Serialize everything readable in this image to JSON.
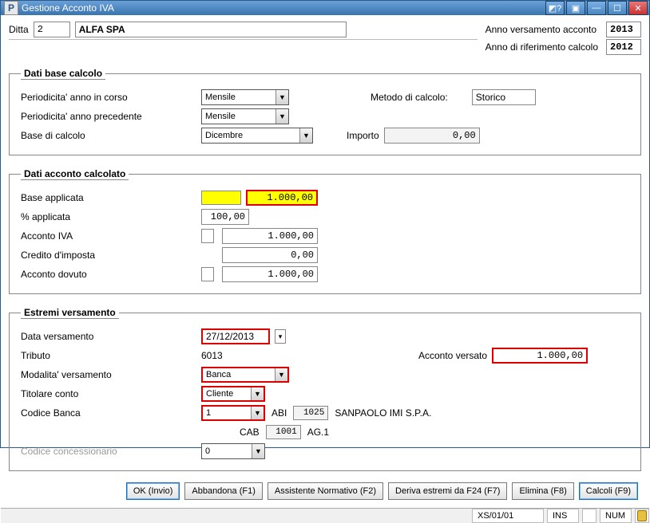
{
  "window": {
    "title": "Gestione Acconto IVA"
  },
  "header": {
    "ditta_label": "Ditta",
    "ditta_num": "2",
    "ditta_name": "ALFA SPA",
    "year_vers_label": "Anno versamento acconto",
    "year_vers_value": "2013",
    "year_calc_label": "Anno di riferimento calcolo",
    "year_calc_value": "2012"
  },
  "base": {
    "legend": "Dati base calcolo",
    "period_corso_label": "Periodicita' anno in corso",
    "period_corso_value": "Mensile",
    "method_label": "Metodo di calcolo:",
    "method_value": "Storico",
    "period_prec_label": "Periodicita' anno precedente",
    "period_prec_value": "Mensile",
    "base_calc_label": "Base di calcolo",
    "base_calc_value": "Dicembre",
    "importo_label": "Importo",
    "importo_value": "0,00"
  },
  "calc": {
    "legend": "Dati acconto calcolato",
    "base_app_label": "Base applicata",
    "base_app_value": "1.000,00",
    "pct_label": "% applicata",
    "pct_value": "100,00",
    "iva_label": "Acconto IVA",
    "iva_value": "1.000,00",
    "credito_label": "Credito d'imposta",
    "credito_value": "0,00",
    "dovuto_label": "Acconto dovuto",
    "dovuto_value": "1.000,00"
  },
  "vers": {
    "legend": "Estremi versamento",
    "data_label": "Data versamento",
    "data_value": "27/12/2013",
    "tributo_label": "Tributo",
    "tributo_value": "6013",
    "versato_label": "Acconto versato",
    "versato_value": "1.000,00",
    "mod_label": "Modalita' versamento",
    "mod_value": "Banca",
    "tit_label": "Titolare conto",
    "tit_value": "Cliente",
    "codbanca_label": "Codice Banca",
    "codbanca_value": "1",
    "abi_label": "ABI",
    "abi_value": "1025",
    "bank_name": "SANPAOLO IMI S.P.A.",
    "cab_label": "CAB",
    "cab_value": "1001",
    "branch": "AG.1",
    "conc_label": "Codice concessionario",
    "conc_value": "0"
  },
  "buttons": {
    "ok": "OK (Invio)",
    "abbandona": "Abbandona (F1)",
    "assistente": "Assistente Normativo (F2)",
    "deriva": "Deriva estremi da F24 (F7)",
    "elimina": "Elimina (F8)",
    "calcoli": "Calcoli (F9)"
  },
  "status": {
    "code": "XS/01/01",
    "ins": "INS",
    "num": "NUM"
  }
}
